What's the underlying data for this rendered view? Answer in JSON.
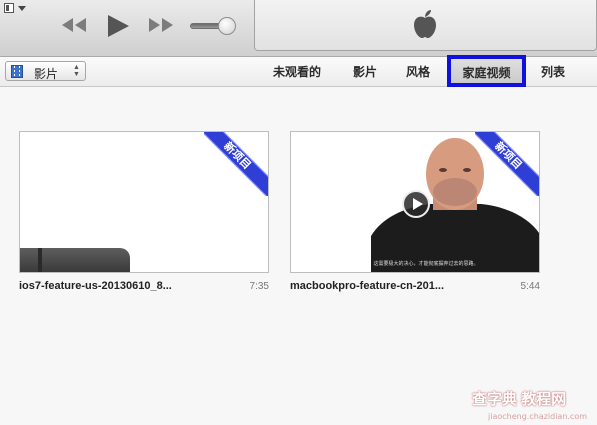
{
  "player": {
    "menu_icon": "window-menu-icon",
    "prev_icon": "rewind-icon",
    "play_icon": "play-icon",
    "next_icon": "fast-forward-icon",
    "volume_level": 0.7,
    "lcd_icon": "apple-logo-icon"
  },
  "toolbar": {
    "library_label": "影片",
    "library_icon": "film-icon",
    "tabs": [
      {
        "label": "未观看的"
      },
      {
        "label": "影片"
      },
      {
        "label": "风格"
      },
      {
        "label": "家庭视频",
        "selected": true
      },
      {
        "label": "列表"
      }
    ]
  },
  "videos": [
    {
      "title": "ios7-feature-us-20130610_8...",
      "duration": "7:35",
      "badge": "新项目"
    },
    {
      "title": "macbookpro-feature-cn-201...",
      "duration": "5:44",
      "badge": "新项目",
      "subtitle": "这需要极大的决心，才能彻底摒弃过去的思路。"
    }
  ],
  "watermark": {
    "text": "查字典 教程网",
    "url": "jiaocheng.chazidian.com"
  },
  "colors": {
    "highlight_border": "#1010e0",
    "badge_blue": "#2f3fd6"
  }
}
